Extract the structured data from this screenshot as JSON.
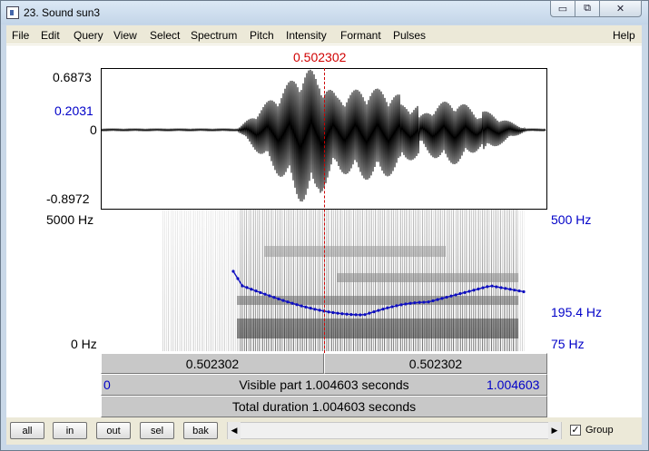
{
  "window": {
    "title": "23. Sound sun3",
    "min_glyph": "▭",
    "max_glyph": "⧉",
    "close_glyph": "✕"
  },
  "menu": [
    "File",
    "Edit",
    "Query",
    "View",
    "Select",
    "Spectrum",
    "Pitch",
    "Intensity",
    "Formant",
    "Pulses",
    "Help"
  ],
  "cursor_time": "0.502302",
  "waveform": {
    "y_max": "0.6873",
    "y_mark": "0.2031",
    "y_zero": "0",
    "y_min": "-0.8972"
  },
  "spectrogram": {
    "freq_max": "5000 Hz",
    "freq_min": "0 Hz",
    "pitch_max": "500 Hz",
    "pitch_value": "195.4 Hz",
    "pitch_min": "75 Hz"
  },
  "timebar": {
    "left_segment": "0.502302",
    "right_segment": "0.502302",
    "visible_start": "0",
    "visible_label": "Visible part 1.004603 seconds",
    "visible_end": "1.004603",
    "total_label": "Total duration 1.004603 seconds"
  },
  "toolbar": {
    "all": "all",
    "in": "in",
    "out": "out",
    "sel": "sel",
    "bak": "bak",
    "group_label": "Group",
    "group_checked": "✓"
  },
  "colors": {
    "cursor": "#d00000",
    "axis_blue": "#0000c8",
    "pitch_curve": "#1010c0"
  }
}
